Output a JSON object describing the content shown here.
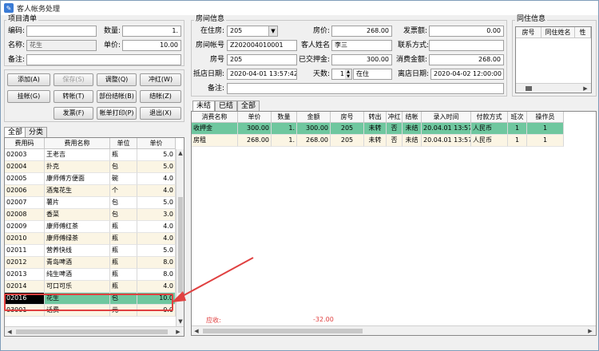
{
  "window": {
    "title": "客人帐务处理"
  },
  "item_panel": {
    "title": "项目清单",
    "code_label": "编码:",
    "code_value": "",
    "qty_label": "数量:",
    "qty_value": "1.",
    "name_label": "名称:",
    "name_value": "花生",
    "price_label": "单价:",
    "price_value": "10.00",
    "remark_label": "备注:",
    "remark_value": ""
  },
  "buttons": {
    "add": "添加(A)",
    "save": "保存(S)",
    "adjust": "调整(Q)",
    "reverse": "冲红(W)",
    "hang": "挂帐(G)",
    "transfer": "转帐(T)",
    "partial": "部份结帐(B)",
    "checkout": "结帐(Z)",
    "invoice": "发票(F)",
    "print": "帐单打印(P)",
    "exit": "退出(X)"
  },
  "item_tabs": [
    "全部",
    "分类"
  ],
  "item_table": {
    "headers": [
      "费用码",
      "费用名称",
      "单位",
      "单价"
    ],
    "rows": [
      {
        "code": "02003",
        "name": "王老吉",
        "unit": "瓶",
        "price": "5.0"
      },
      {
        "code": "02004",
        "name": "扑克",
        "unit": "包",
        "price": "5.0"
      },
      {
        "code": "02005",
        "name": "康师傅方便面",
        "unit": "碗",
        "price": "4.0"
      },
      {
        "code": "02006",
        "name": "酒鬼花生",
        "unit": "个",
        "price": "4.0"
      },
      {
        "code": "02007",
        "name": "薯片",
        "unit": "包",
        "price": "5.0"
      },
      {
        "code": "02008",
        "name": "香菜",
        "unit": "包",
        "price": "3.0"
      },
      {
        "code": "02009",
        "name": "康师傅红茶",
        "unit": "瓶",
        "price": "4.0"
      },
      {
        "code": "02010",
        "name": "康师傅绿茶",
        "unit": "瓶",
        "price": "4.0"
      },
      {
        "code": "02011",
        "name": "营养快线",
        "unit": "瓶",
        "price": "5.0"
      },
      {
        "code": "02012",
        "name": "青岛啤酒",
        "unit": "瓶",
        "price": "8.0"
      },
      {
        "code": "02013",
        "name": "纯生啤酒",
        "unit": "瓶",
        "price": "8.0"
      },
      {
        "code": "02014",
        "name": "可口可乐",
        "unit": "瓶",
        "price": "4.0"
      },
      {
        "code": "02016",
        "name": "花生",
        "unit": "包",
        "price": "10.0"
      },
      {
        "code": "03001",
        "name": "话费",
        "unit": "元",
        "price": "0.0"
      }
    ]
  },
  "room_panel": {
    "title": "房间信息",
    "room_label": "在住房:",
    "room_value": "205",
    "price_label": "房价:",
    "price_value": "268.00",
    "invoice_label": "发票额:",
    "invoice_value": "0.00",
    "account_label": "房间帐号",
    "account_value": "Z202004010001",
    "guest_label": "客人姓名",
    "guest_value": "李三",
    "contact_label": "联系方式:",
    "contact_value": "",
    "roomno_label": "房号",
    "roomno_value": "205",
    "deposit_label": "已交押金:",
    "deposit_value": "300.00",
    "consume_label": "消费金额:",
    "consume_value": "268.00",
    "arrive_label": "抵店日期:",
    "arrive_value": "2020-04-01 13:57:42",
    "days_label": "天数:",
    "days_value": "1",
    "status_value": "在住",
    "depart_label": "离店日期:",
    "depart_value": "2020-04-02 12:00:00",
    "remark_label": "备注:",
    "remark_value": ""
  },
  "cohabit_panel": {
    "title": "同住信息",
    "headers": [
      "房号",
      "同住姓名",
      "性"
    ]
  },
  "bill_tabs": [
    "未结",
    "已结",
    "全部"
  ],
  "bill_table": {
    "headers": [
      "消费名称",
      "单价",
      "数量",
      "金额",
      "房号",
      "转出",
      "冲红",
      "结帐",
      "录入时间",
      "付款方式",
      "班次",
      "操作员"
    ],
    "rows": [
      {
        "name": "收押金",
        "price": "300.00",
        "qty": "1.",
        "amount": "300.00",
        "room": "205",
        "out": "未转",
        "red": "否",
        "settle": "未结",
        "time": "20.04.01 13:57",
        "pay": "人民币",
        "shift": "1",
        "op": "1"
      },
      {
        "name": "房租",
        "price": "268.00",
        "qty": "1.",
        "amount": "268.00",
        "room": "205",
        "out": "未转",
        "red": "否",
        "settle": "未结",
        "time": "20.04.01 13:57",
        "pay": "人民币",
        "shift": "1",
        "op": "1"
      }
    ]
  },
  "footer": {
    "receivable_label": "应收:",
    "receivable_value": "-32.00"
  },
  "colors": {
    "selected_row": "#6fc79f",
    "alt_row": "#fbf5e4",
    "annotation": "#e04040"
  }
}
